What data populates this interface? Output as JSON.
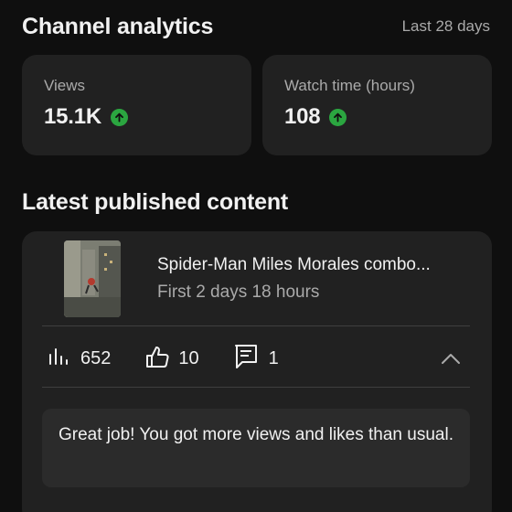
{
  "header": {
    "title": "Channel analytics",
    "period": "Last 28 days"
  },
  "cards": [
    {
      "label": "Views",
      "value": "15.1K",
      "trend": "up"
    },
    {
      "label": "Watch time (hours)",
      "value": "108",
      "trend": "up"
    }
  ],
  "latest": {
    "title": "Latest published content",
    "video": {
      "title": "Spider-Man Miles Morales combo...",
      "subtitle": "First 2 days 18 hours"
    },
    "stats": {
      "views": "652",
      "likes": "10",
      "comments": "1"
    },
    "tip": "Great job! You got more views and likes than usual."
  },
  "colors": {
    "background": "#0f0f0f",
    "card": "#212121",
    "trend_up": "#2ba640",
    "secondary_text": "#aaaaaa"
  },
  "icons": {
    "trend": "arrow-up-circle-icon",
    "views": "bar-chart-icon",
    "likes": "thumbs-up-icon",
    "comments": "comment-icon",
    "collapse": "chevron-up-icon"
  }
}
